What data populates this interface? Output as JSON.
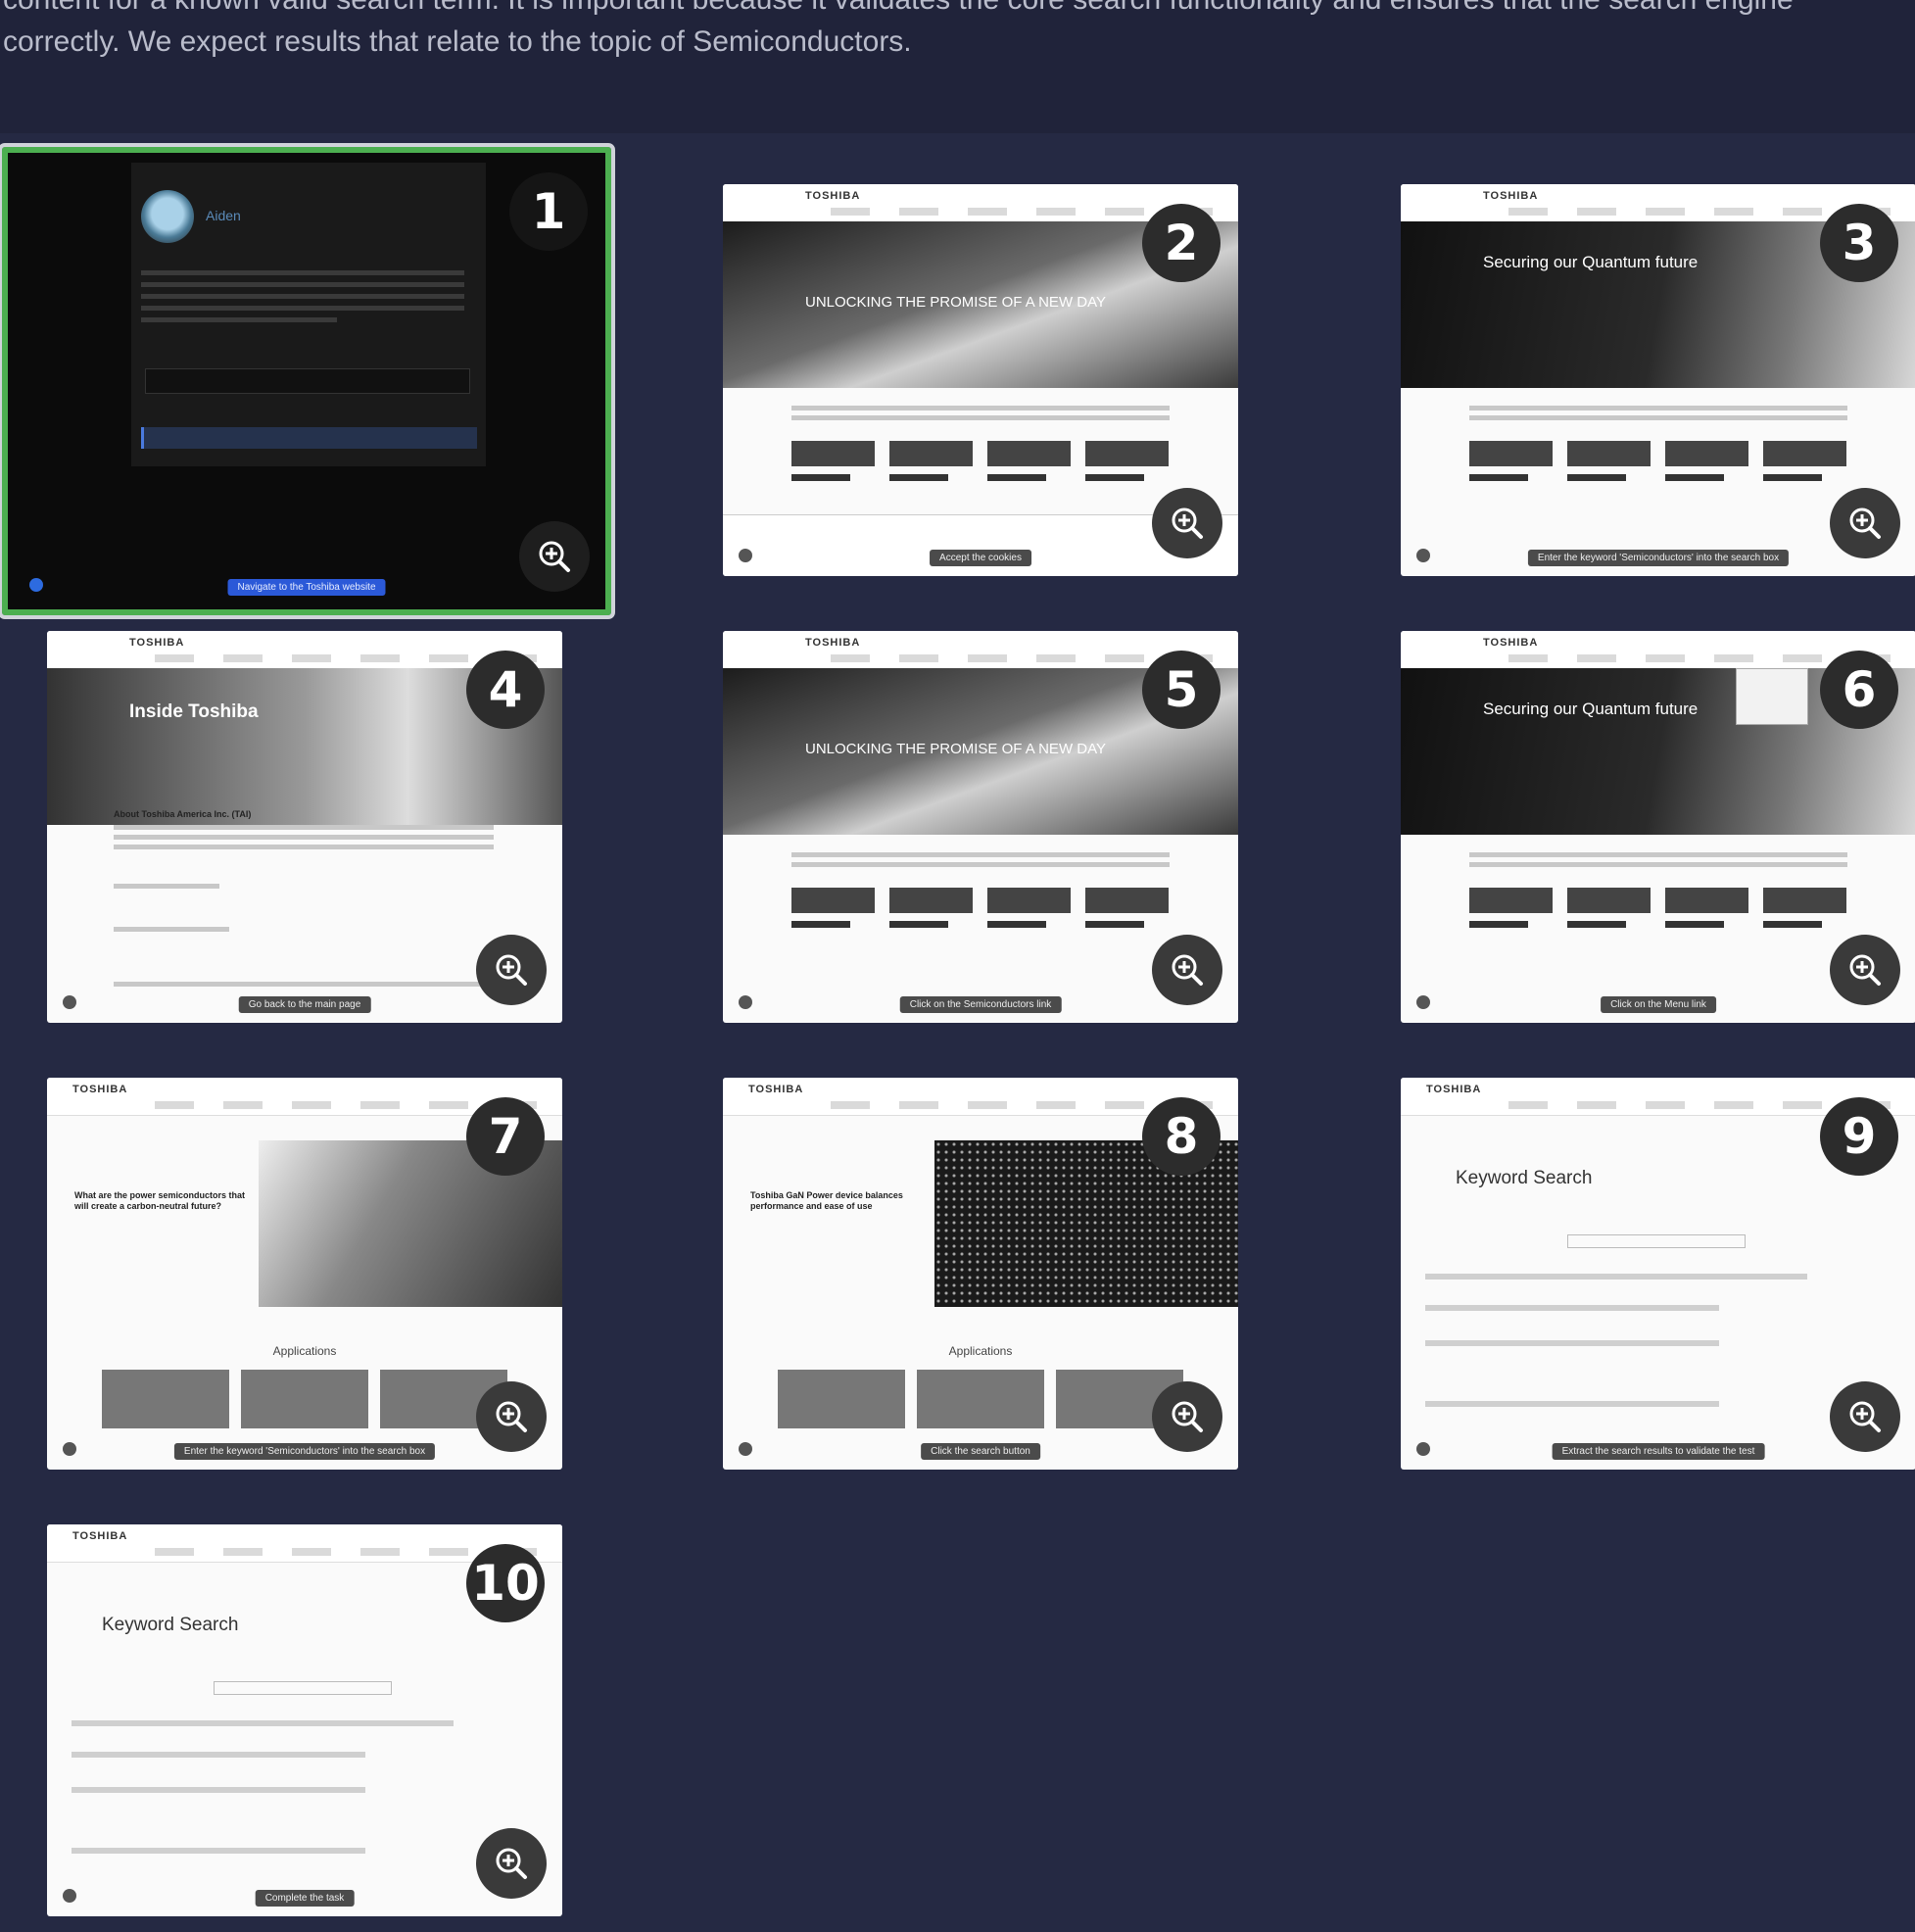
{
  "description": {
    "line1": "content for a known valid search term. It is important because it validates the core search functionality and ensures that the search engine",
    "line2": "correctly. We expect results that relate to the topic of Semiconductors."
  },
  "tiles": [
    {
      "number": "1",
      "agent_name": "Aiden",
      "caption": "Navigate to the Toshiba website",
      "selected": true
    },
    {
      "number": "2",
      "hero_title": "UNLOCKING THE PROMISE OF A NEW DAY",
      "caption": "Accept the cookies"
    },
    {
      "number": "3",
      "hero_title": "Securing our Quantum future",
      "caption": "Enter the keyword 'Semiconductors' into the search box"
    },
    {
      "number": "4",
      "hero_title": "Inside Toshiba",
      "section_title": "About Toshiba America Inc. (TAI)",
      "caption": "Go back to the main page"
    },
    {
      "number": "5",
      "hero_title": "UNLOCKING THE PROMISE OF A NEW DAY",
      "caption": "Click on the Semiconductors link"
    },
    {
      "number": "6",
      "hero_title": "Securing our Quantum future",
      "caption": "Click on the Menu link"
    },
    {
      "number": "7",
      "section_title": "What are the power semiconductors that will create a carbon-neutral future?",
      "apps_title": "Applications",
      "caption": "Enter the keyword 'Semiconductors' into the search box"
    },
    {
      "number": "8",
      "section_title": "Toshiba GaN Power device balances performance and ease of use",
      "apps_title": "Applications",
      "caption": "Click the search button"
    },
    {
      "number": "9",
      "page_title": "Keyword Search",
      "caption": "Extract the search results to validate the test"
    },
    {
      "number": "10",
      "page_title": "Keyword Search",
      "caption": "Complete the task"
    }
  ],
  "site": {
    "logo": "TOSHIBA"
  }
}
